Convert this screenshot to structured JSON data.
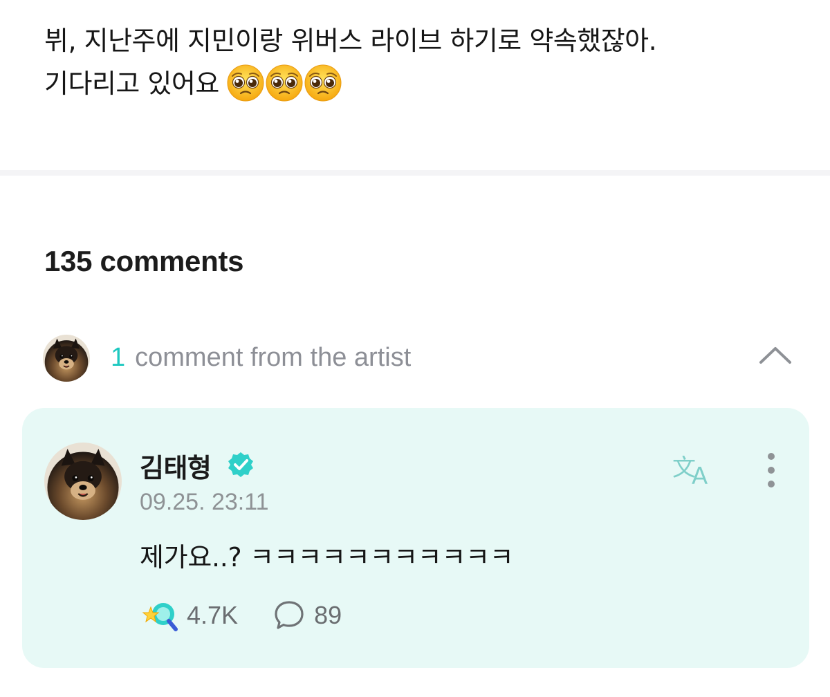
{
  "post": {
    "line1": "뷔, 지난주에 지민이랑 위버스 라이브 하기로 약속했잖아.",
    "line2": "기다리고 있어요",
    "emoji": "pleading-face-emoji"
  },
  "comments": {
    "count_label": "135 comments"
  },
  "artist_comments": {
    "count": "1",
    "label": "comment from the artist",
    "expand_icon": "chevron-up-icon"
  },
  "artist_comment": {
    "author": "김태형",
    "verified_icon": "verified-badge-icon",
    "timestamp": "09.25. 23:11",
    "text": "제가요..? ㅋㅋㅋㅋㅋㅋㅋㅋㅋㅋㅋ",
    "likes": "4.7K",
    "replies": "89",
    "translate_icon": "translate-icon",
    "more_icon": "more-vertical-icon",
    "like_icon": "star-cheer-icon",
    "reply_icon": "speech-bubble-icon"
  },
  "colors": {
    "accent": "#1ec8c0",
    "card_background": "#e7f9f6",
    "secondary_text": "#8d8f96"
  }
}
